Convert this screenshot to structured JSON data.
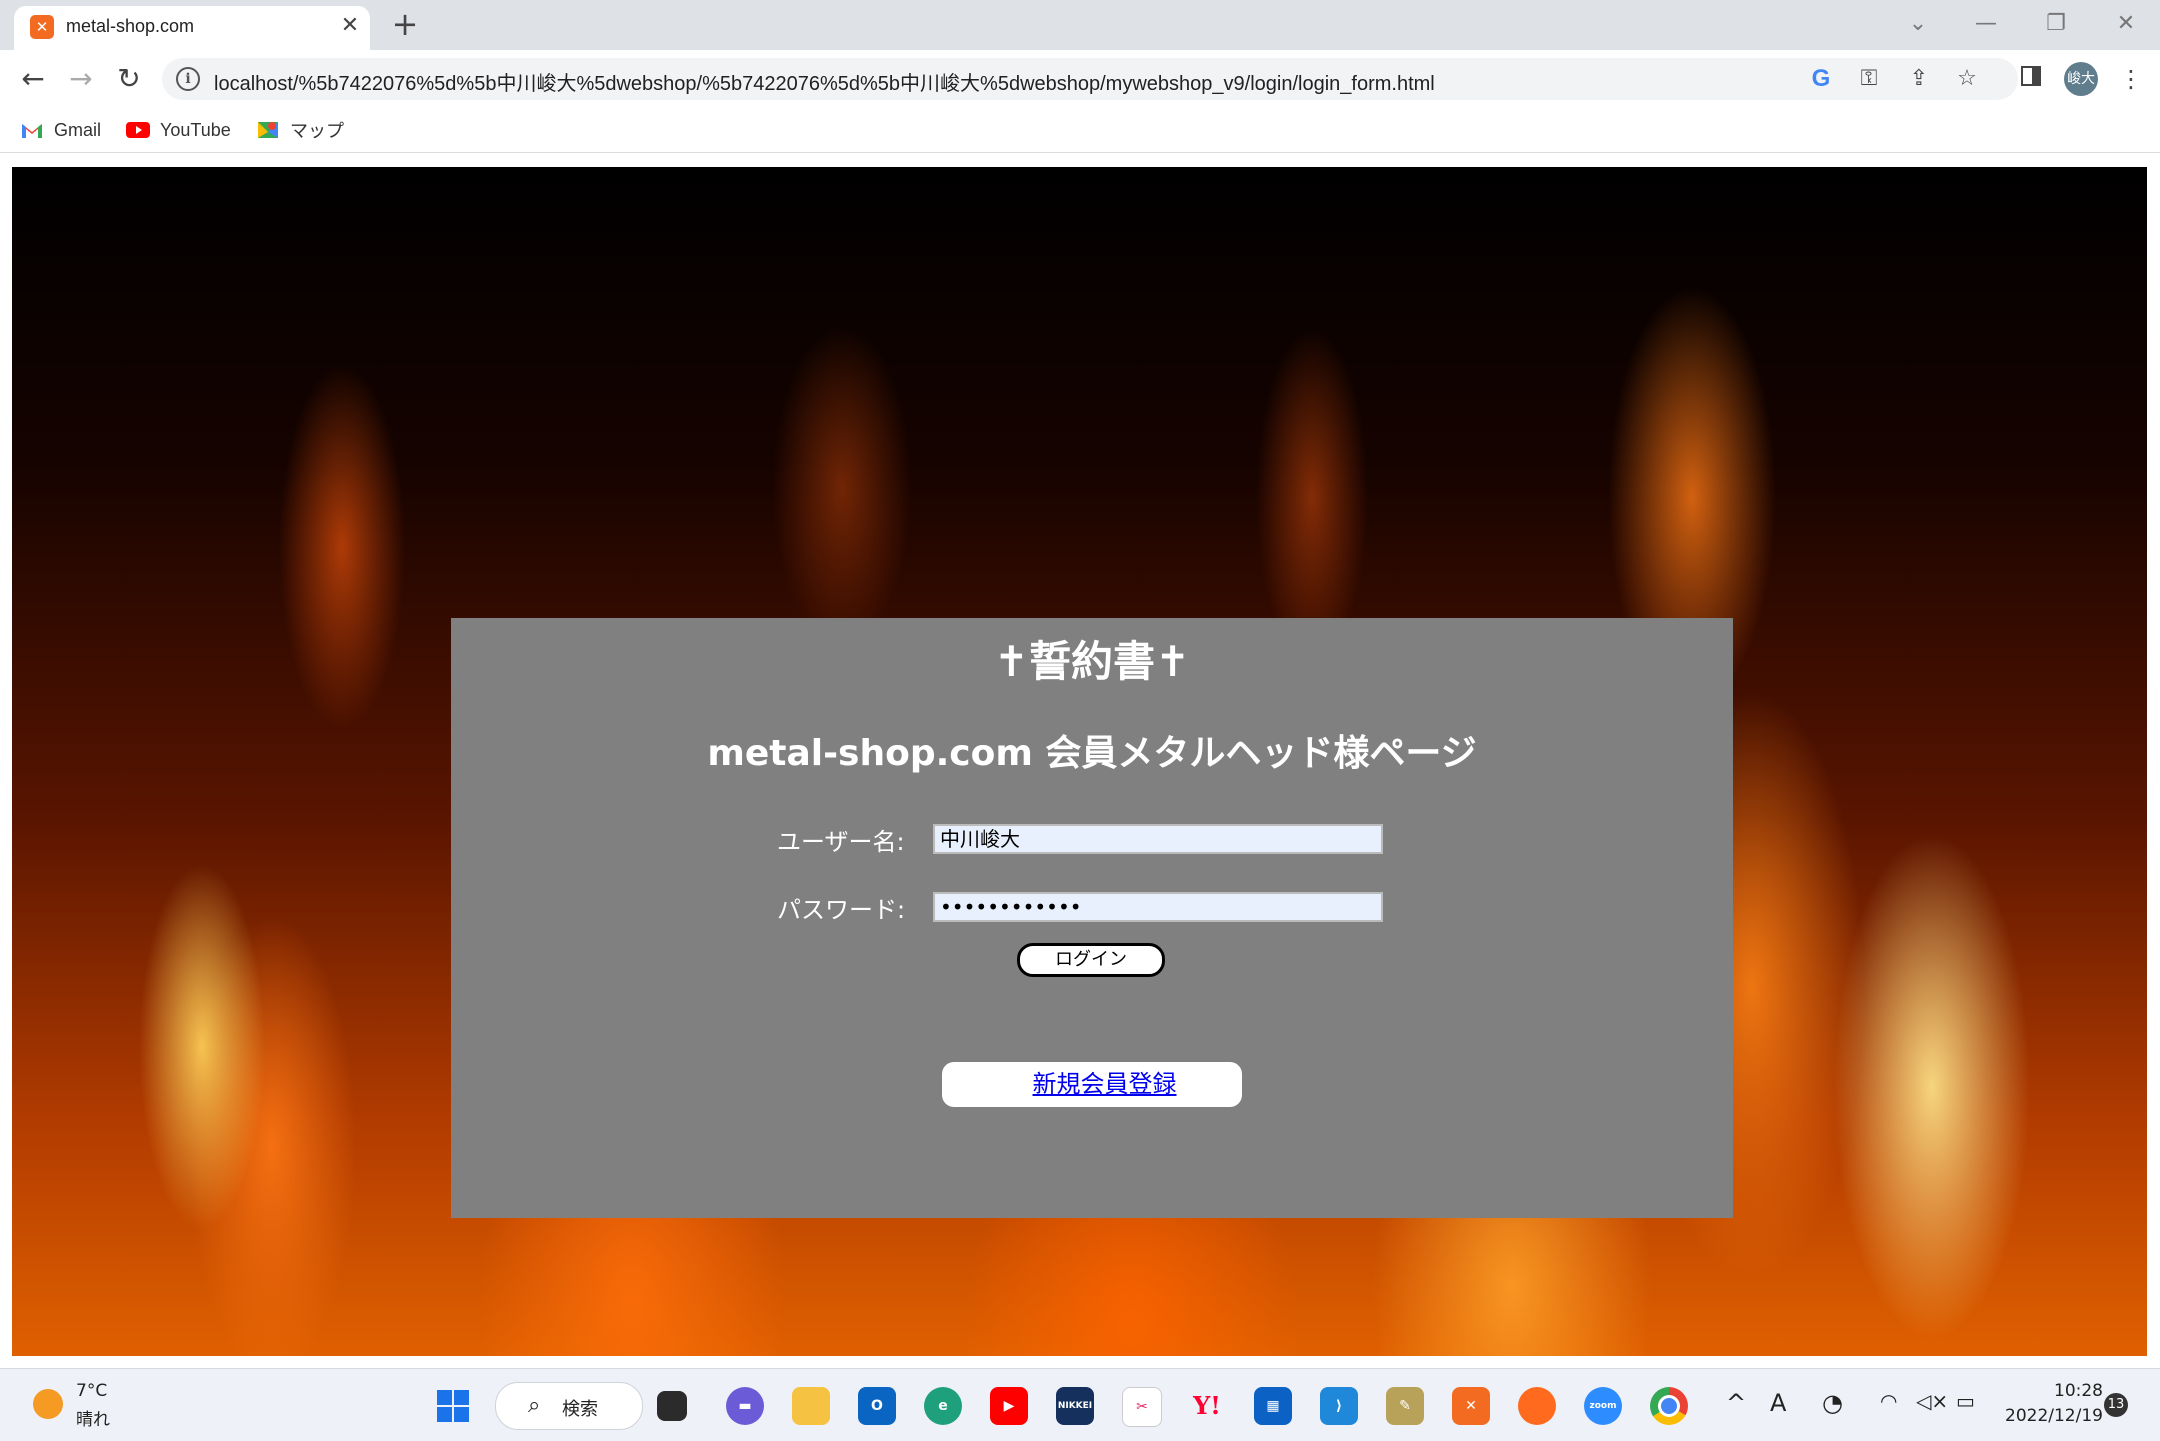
{
  "browser": {
    "tab": {
      "title": "metal-shop.com",
      "favicon": "xampp-icon",
      "close": "✕"
    },
    "new_tab": "+",
    "window_controls": {
      "dropdown": "⌄",
      "minimize": "—",
      "restore": "❐",
      "close": "✕"
    },
    "nav": {
      "back": "←",
      "forward": "→",
      "reload": "↻"
    },
    "url": "localhost/%5b7422076%5d%5b中川峻大%5dwebshop/%5b7422076%5d%5b中川峻大%5dwebshop/mywebshop_v9/login/login_form.html",
    "omni_icons": {
      "google": "G",
      "key": "⚿",
      "share": "⇪",
      "star": "☆"
    },
    "profile_initials": "峻大",
    "bookmarks": [
      {
        "label": "Gmail",
        "icon": "gmail-icon"
      },
      {
        "label": "YouTube",
        "icon": "youtube-icon"
      },
      {
        "label": "マップ",
        "icon": "maps-icon"
      }
    ]
  },
  "page": {
    "title": "✝誓約書✝",
    "subtitle": "metal-shop.com 会員メタルヘッド様ページ",
    "username_label": "ユーザー名:",
    "username_value": "中川峻大",
    "password_label": "パスワード:",
    "password_value": "••••••••••••",
    "login_button": "ログイン",
    "register_link": "新規会員登録"
  },
  "taskbar": {
    "weather": {
      "temp": "7°C",
      "desc": "晴れ"
    },
    "search_label": "検索",
    "apps": [
      "windows-start-icon",
      "task-view-icon",
      "chat-icon",
      "file-explorer-icon",
      "outlook-icon",
      "edge-icon",
      "youtube-icon",
      "nikkei-icon",
      "snipping-tool-icon",
      "yahoo-icon",
      "store-icon",
      "vscode-icon",
      "app-icon",
      "xampp-icon",
      "firefox-icon",
      "zoom-icon",
      "chrome-icon"
    ],
    "nikkei_label": "NIKKEI",
    "zoom_label": "zoom",
    "yahoo_label": "Y!",
    "ime": "A",
    "clock": {
      "time": "10:28",
      "date": "2022/12/19"
    },
    "notifications": "13"
  }
}
